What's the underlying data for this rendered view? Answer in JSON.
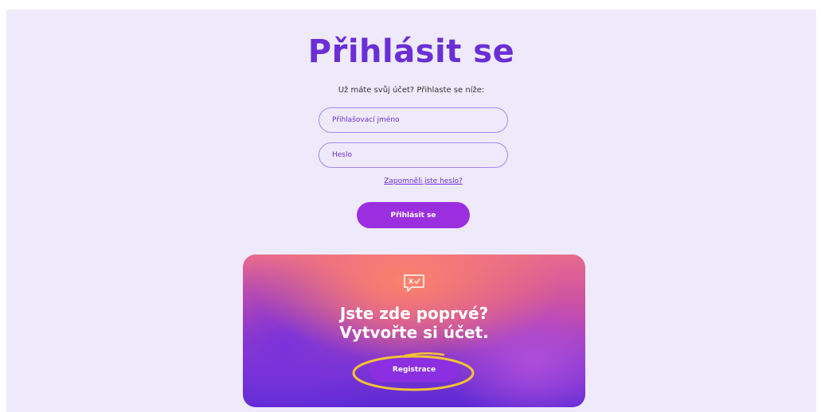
{
  "login": {
    "title": "Přihlásit se",
    "subtitle": "Už máte svůj účet? Přihlaste se níže:",
    "username_placeholder": "Přihlašovací jméno",
    "password_placeholder": "Heslo",
    "forgot_link": "Zapomněli jste heslo?",
    "submit_label": "Přihlásit se"
  },
  "register_card": {
    "icon": "chat-check-icon",
    "title_line1": "Jste zde poprvé?",
    "title_line2": "Vytvořte si účet.",
    "button_label": "Registrace"
  },
  "colors": {
    "accent": "#6a2fd6",
    "button": "#9b2fe0",
    "background": "#efeafb",
    "highlight_ring": "#f2c335"
  }
}
